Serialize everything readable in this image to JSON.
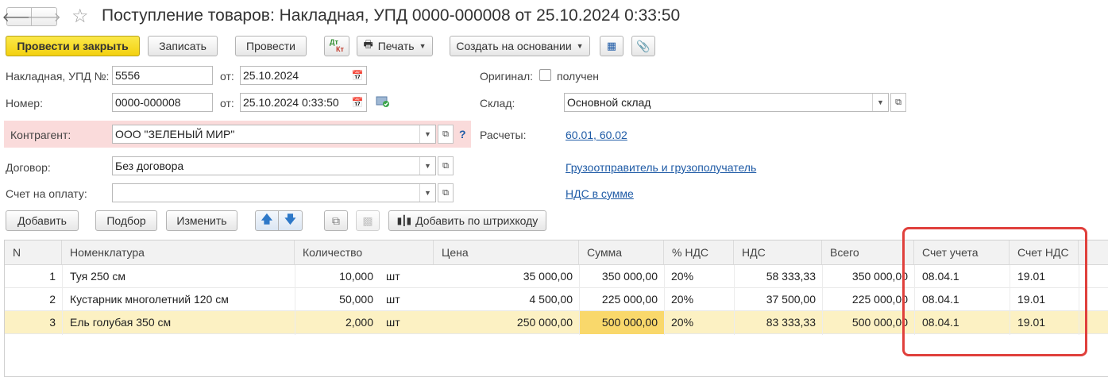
{
  "header": {
    "title": "Поступление товаров: Накладная, УПД 0000-000008 от 25.10.2024 0:33:50"
  },
  "toolbar": {
    "post_close": "Провести и закрыть",
    "save": "Записать",
    "post": "Провести",
    "dtkt_top": "Дт",
    "dtkt_bottom": "Кт",
    "print": "Печать",
    "create_based": "Создать на основании"
  },
  "form": {
    "invoice_label": "Накладная, УПД №:",
    "invoice_value": "5556",
    "from_label": "от:",
    "invoice_date": "25.10.2024",
    "number_label": "Номер:",
    "number_value": "0000-000008",
    "number_date": "25.10.2024  0:33:50",
    "original_label": "Оригинал:",
    "original_checkbox_label": "получен",
    "warehouse_label": "Склад:",
    "warehouse_value": "Основной склад",
    "counterparty_label": "Контрагент:",
    "counterparty_value": "ООО \"ЗЕЛЕНЫЙ МИР\"",
    "help": "?",
    "settlements_label": "Расчеты:",
    "settlements_link": "60.01, 60.02",
    "contract_label": "Договор:",
    "contract_value": "Без договора",
    "consignor_link": "Грузоотправитель и грузополучатель",
    "payment_invoice_label": "Счет на оплату:",
    "vat_link": "НДС в сумме"
  },
  "table_toolbar": {
    "add": "Добавить",
    "pick": "Подбор",
    "edit": "Изменить",
    "add_barcode": "Добавить по штрихкоду"
  },
  "table": {
    "headers": [
      "N",
      "Номенклатура",
      "Количество",
      "Цена",
      "Сумма",
      "% НДС",
      "НДС",
      "Всего",
      "Счет учета",
      "Счет НДС"
    ],
    "rows": [
      {
        "n": "1",
        "name": "Туя 250 см",
        "qty": "10,000",
        "unit": "шт",
        "price": "35 000,00",
        "sum": "350 000,00",
        "vat_rate": "20%",
        "vat": "58 333,33",
        "total": "350 000,00",
        "account": "08.04.1",
        "vat_account": "19.01"
      },
      {
        "n": "2",
        "name": "Кустарник многолетний 120 см",
        "qty": "50,000",
        "unit": "шт",
        "price": "4 500,00",
        "sum": "225 000,00",
        "vat_rate": "20%",
        "vat": "37 500,00",
        "total": "225 000,00",
        "account": "08.04.1",
        "vat_account": "19.01"
      },
      {
        "n": "3",
        "name": "Ель голубая 350 см",
        "qty": "2,000",
        "unit": "шт",
        "price": "250 000,00",
        "sum": "500 000,00",
        "vat_rate": "20%",
        "vat": "83 333,33",
        "total": "500 000,00",
        "account": "08.04.1",
        "vat_account": "19.01"
      }
    ]
  },
  "colors": {
    "primary_button": "#f3d10f",
    "counterparty_bg": "#fadbdb",
    "selected_row": "#fcf1c3",
    "highlighted_cell": "#f9d86b",
    "annotation_box": "#e0403c",
    "link": "#1f5ba6"
  }
}
